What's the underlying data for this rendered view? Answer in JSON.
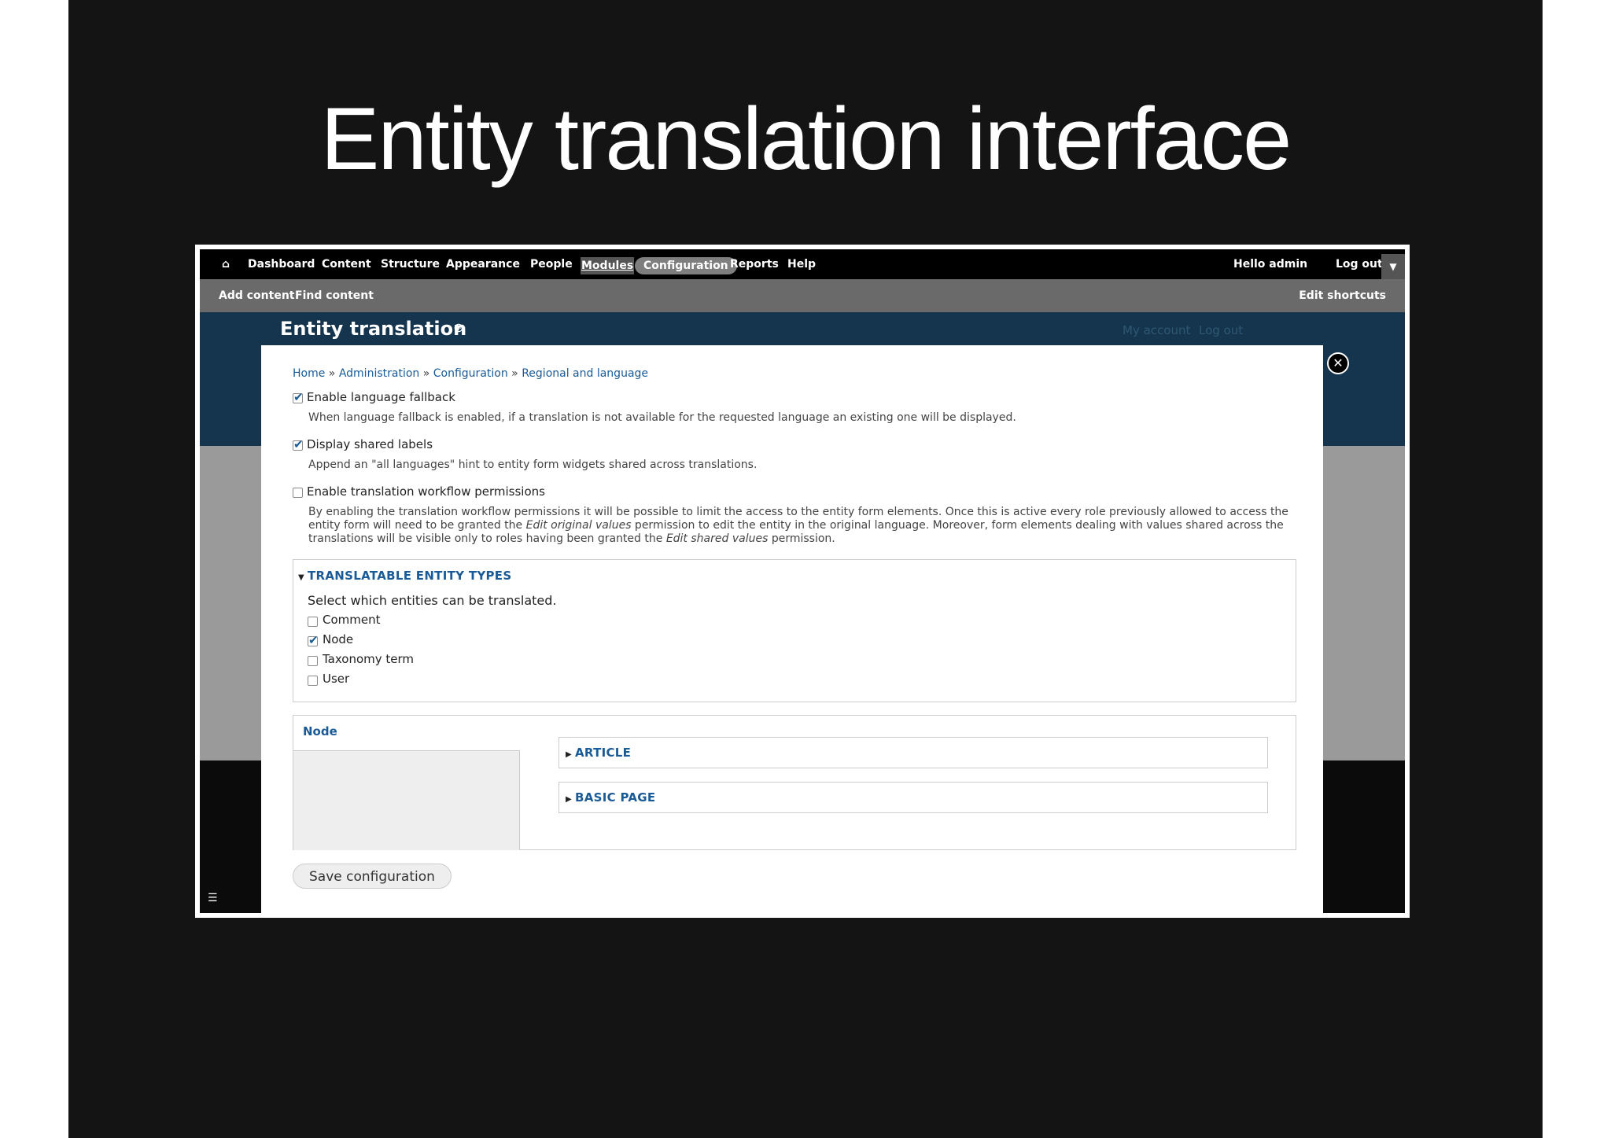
{
  "slide": {
    "title": "Entity translation interface"
  },
  "toolbar": {
    "items": [
      "Dashboard",
      "Content",
      "Structure",
      "Appearance",
      "People",
      "Modules",
      "Configuration",
      "Reports",
      "Help"
    ],
    "hello": "Hello admin",
    "logout": "Log out",
    "home_icon": "home-icon",
    "toggle_icon": "chevron-down-icon"
  },
  "shortcuts": {
    "add_content": "Add content",
    "find_content": "Find content",
    "edit_shortcuts": "Edit shortcuts"
  },
  "page": {
    "title": "Entity translation",
    "my_account": "My account",
    "log_out": "Log out"
  },
  "overlay": {
    "breadcrumb": [
      "Home",
      "Administration",
      "Configuration",
      "Regional and language"
    ],
    "breadcrumb_sep": "»",
    "options": [
      {
        "label": "Enable language fallback",
        "checked": true,
        "description": "When language fallback is enabled, if a translation is not available for the requested language an existing one will be displayed."
      },
      {
        "label": "Display shared labels",
        "checked": true,
        "description": "Append an \"all languages\" hint to entity form widgets shared across translations."
      },
      {
        "label": "Enable translation workflow permissions",
        "checked": false,
        "description_parts": {
          "p1": "By enabling the translation workflow permissions it will be possible to limit the access to the entity form elements. Once this is active every role previously allowed to access the entity form will need to be granted the ",
          "em1": "Edit original values",
          "p2": " permission to edit the entity in the original language. Moreover, form elements dealing with values shared across the translations will be visible only to roles having been granted the ",
          "em2": "Edit shared values",
          "p3": " permission."
        }
      }
    ],
    "entity_types": {
      "legend": "TRANSLATABLE ENTITY TYPES",
      "help": "Select which entities can be translated.",
      "items": [
        {
          "label": "Comment",
          "checked": false
        },
        {
          "label": "Node",
          "checked": true
        },
        {
          "label": "Taxonomy term",
          "checked": false
        },
        {
          "label": "User",
          "checked": false
        }
      ]
    },
    "node_section": {
      "tab_label": "Node",
      "bundles": [
        "ARTICLE",
        "BASIC PAGE"
      ]
    },
    "save_button": "Save configuration"
  }
}
